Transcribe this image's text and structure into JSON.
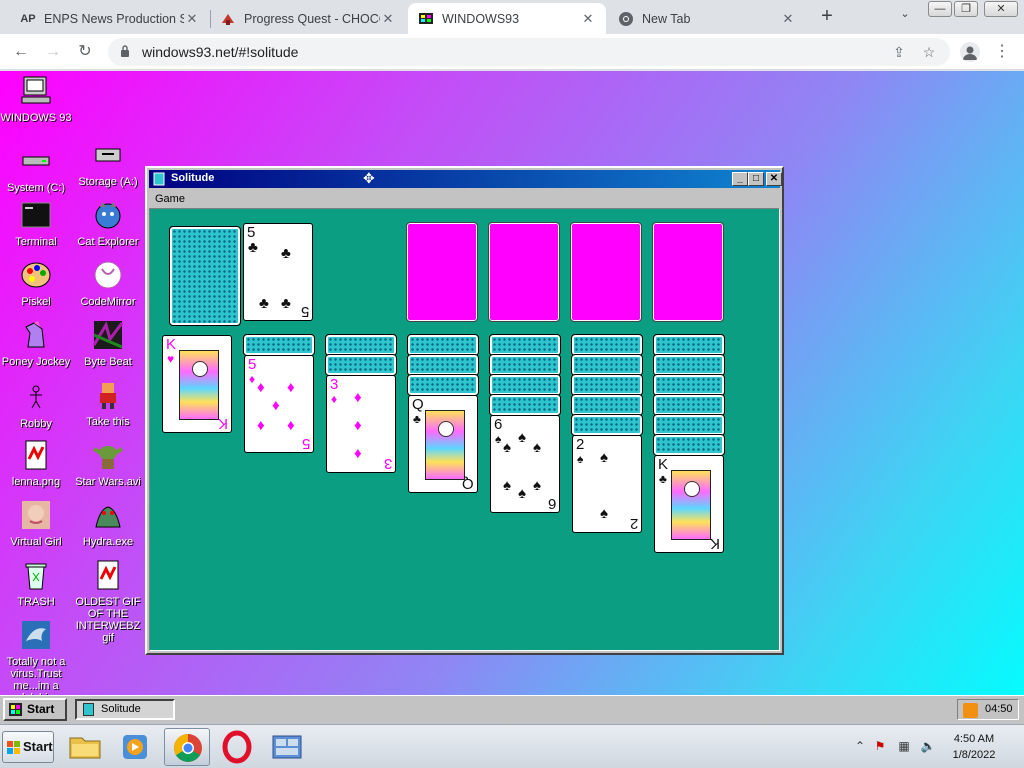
{
  "browser": {
    "tabs": [
      {
        "title": "ENPS News Production S",
        "favicon": "AP"
      },
      {
        "title": "Progress Quest - CHOCO",
        "favicon": "pq-icon"
      },
      {
        "title": "WINDOWS93",
        "favicon": "win93-icon"
      },
      {
        "title": "New Tab",
        "favicon": "chrome-icon"
      }
    ],
    "active_tab": 2,
    "url": "windows93.net/#!solitude"
  },
  "desktop": {
    "icons": [
      {
        "label": "WINDOWS 93"
      },
      {
        "label": "System (C:)"
      },
      {
        "label": "Storage (A:)"
      },
      {
        "label": "Terminal"
      },
      {
        "label": "Cat Explorer"
      },
      {
        "label": "Piskel"
      },
      {
        "label": "CodeMirror"
      },
      {
        "label": "Poney Jockey"
      },
      {
        "label": "Byte Beat"
      },
      {
        "label": "Robby"
      },
      {
        "label": "Take this"
      },
      {
        "label": "lenna.png"
      },
      {
        "label": "Star Wars.avi"
      },
      {
        "label": "Virtual Girl"
      },
      {
        "label": "Hydra.exe"
      },
      {
        "label": "TRASH"
      },
      {
        "label": "OLDEST GIF OF THE INTERWEBZ gif"
      },
      {
        "label": "Totally not a virus.Trust me...im a dolphin"
      }
    ]
  },
  "solitude": {
    "title": "Solitude",
    "menu": [
      "Game"
    ],
    "waste_card": {
      "rank": "5",
      "suit": "♣",
      "color": "black"
    },
    "tableau": [
      {
        "hidden": 0,
        "top": {
          "rank": "K",
          "suit": "♥",
          "color": "red"
        }
      },
      {
        "hidden": 1,
        "top": {
          "rank": "5",
          "suit": "♦",
          "color": "red"
        }
      },
      {
        "hidden": 2,
        "top": {
          "rank": "3",
          "suit": "♦",
          "color": "red"
        }
      },
      {
        "hidden": 3,
        "top": {
          "rank": "Q",
          "suit": "♣",
          "color": "black"
        }
      },
      {
        "hidden": 4,
        "top": {
          "rank": "6",
          "suit": "♠",
          "color": "black"
        }
      },
      {
        "hidden": 5,
        "top": {
          "rank": "2",
          "suit": "♠",
          "color": "black"
        }
      },
      {
        "hidden": 6,
        "top": {
          "rank": "K",
          "suit": "♣",
          "color": "black"
        }
      }
    ]
  },
  "w93_taskbar": {
    "start_label": "Start",
    "task_label": "Solitude",
    "tray_time": "04:50"
  },
  "os_taskbar": {
    "start_label": "Start",
    "time": "4:50 AM",
    "date": "1/8/2022"
  }
}
